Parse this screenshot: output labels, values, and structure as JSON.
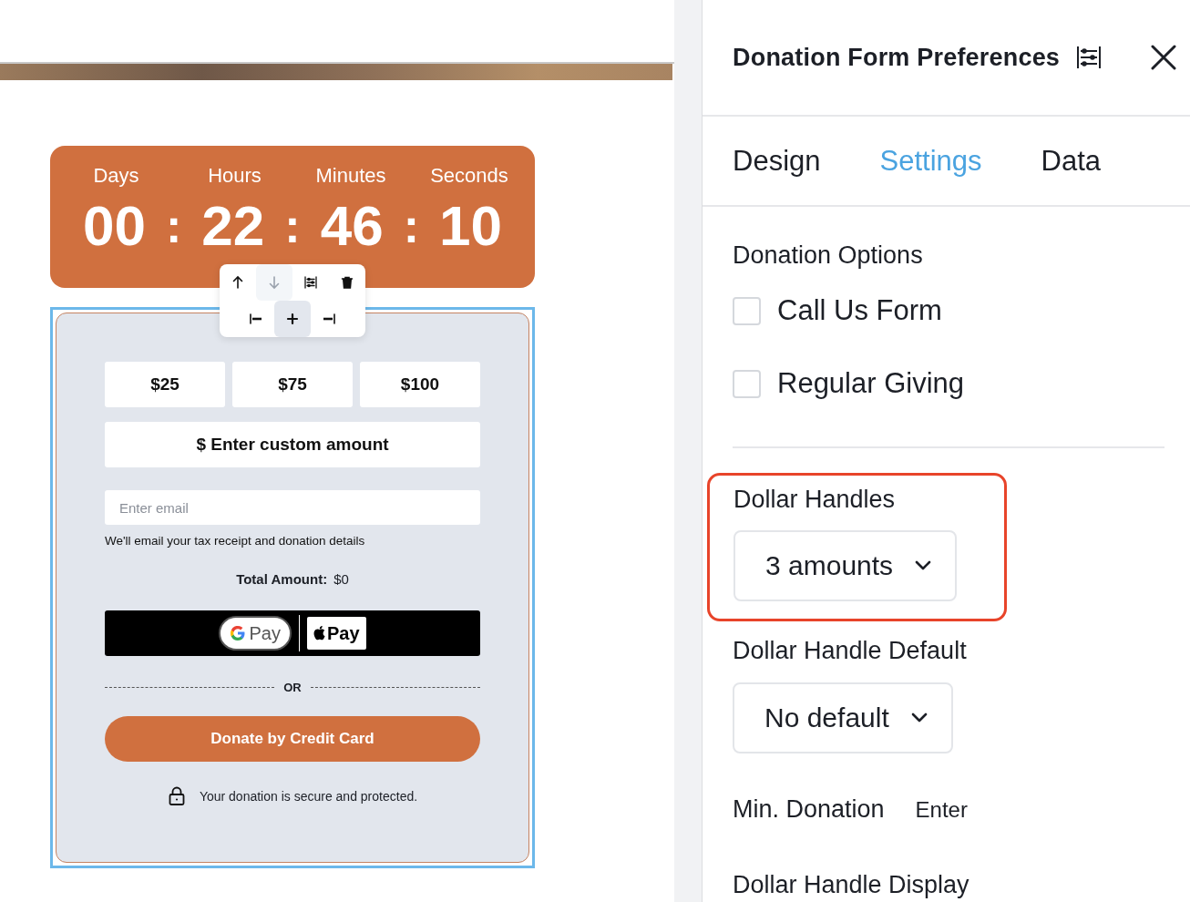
{
  "canvas": {
    "countdown": {
      "units": [
        {
          "label": "Days",
          "value": "00"
        },
        {
          "label": "Hours",
          "value": "22"
        },
        {
          "label": "Minutes",
          "value": "46"
        },
        {
          "label": "Seconds",
          "value": "10"
        }
      ],
      "separator": ":"
    },
    "block_toolbar": {
      "rows": [
        [
          {
            "kind": "move-up",
            "disabled": false,
            "selected": false
          },
          {
            "kind": "move-down",
            "disabled": true,
            "selected": false
          },
          {
            "kind": "settings",
            "disabled": false,
            "selected": false
          },
          {
            "kind": "delete",
            "disabled": false,
            "selected": false
          }
        ],
        [
          {
            "kind": "align-left",
            "disabled": false,
            "selected": false
          },
          {
            "kind": "add",
            "disabled": false,
            "selected": true
          },
          {
            "kind": "align-right",
            "disabled": false,
            "selected": false
          }
        ]
      ]
    },
    "donation_form": {
      "selected": true,
      "amounts": [
        "$25",
        "$75",
        "$100"
      ],
      "custom_amount": "$ Enter custom amount",
      "email": {
        "placeholder": "Enter email"
      },
      "email_note": "We'll email your tax receipt and donation details",
      "total_label": "Total Amount:",
      "total_value": "$0",
      "wallet_buttons": [
        {
          "kind": "google",
          "label": "Pay"
        },
        {
          "kind": "apple",
          "label": "Pay"
        }
      ],
      "separator": "OR",
      "donate_button": "Donate by Credit Card",
      "secure_note": "Your donation is secure and protected."
    }
  },
  "panel": {
    "title": "Donation Form Preferences",
    "tabs": [
      {
        "label": "Design",
        "selected": false
      },
      {
        "label": "Settings",
        "selected": true
      },
      {
        "label": "Data",
        "selected": false
      }
    ],
    "donation_options": {
      "heading": "Donation Options",
      "options": [
        {
          "label": "Call Us Form",
          "checked": false
        },
        {
          "label": "Regular Giving",
          "checked": false
        }
      ]
    },
    "dollar_handles": {
      "label": "Dollar Handles",
      "value": "3 amounts",
      "highlighted": true
    },
    "dollar_handle_default": {
      "label": "Dollar Handle Default",
      "value": "No default"
    },
    "min_donation": {
      "label": "Min. Donation",
      "placeholder": "Enter"
    },
    "dollar_handle_display": {
      "label": "Dollar Handle Display"
    }
  }
}
